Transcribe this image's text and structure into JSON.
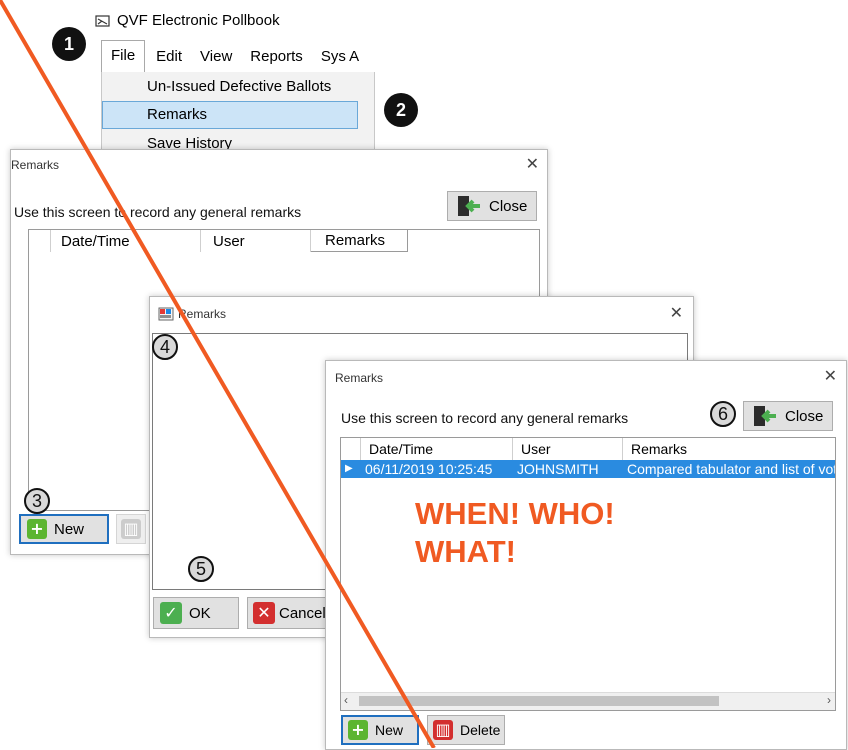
{
  "app": {
    "title": "QVF Electronic Pollbook"
  },
  "menu": {
    "items": [
      "File",
      "Edit",
      "View",
      "Reports",
      "Sys A"
    ],
    "file_dropdown": [
      "Un-Issued Defective Ballots",
      "Remarks",
      "Save History"
    ]
  },
  "steps": [
    "1",
    "2",
    "3",
    "4",
    "5",
    "6"
  ],
  "window1": {
    "title": "Remarks",
    "subtitle": "Use this screen to record any general remarks",
    "close_label": "Close",
    "columns": [
      "Date/Time",
      "User",
      "Remarks"
    ],
    "new_label": "New"
  },
  "window2": {
    "title": "Remarks",
    "ok_label": "OK",
    "cancel_label": "Cancel"
  },
  "window3": {
    "title": "Remarks",
    "subtitle": "Use this screen to record any general remarks",
    "close_label": "Close",
    "columns": [
      "Date/Time",
      "User",
      "Remarks"
    ],
    "rows": [
      {
        "datetime": "06/11/2019 10:25:45",
        "user": "JOHNSMITH",
        "remarks": "Compared tabulator and list of voters"
      }
    ],
    "new_label": "New",
    "delete_label": "Delete"
  },
  "annotation": {
    "line1": "WHEN! WHO!",
    "line2": "WHAT!"
  },
  "colors": {
    "annotation": "#f05a22",
    "selection": "#2a8be0",
    "highlight": "#cce4f7"
  }
}
